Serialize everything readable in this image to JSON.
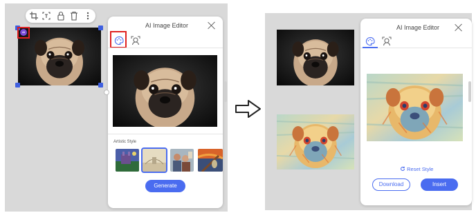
{
  "left_screen": {
    "toolbar": {
      "items": [
        {
          "icon": "crop-icon"
        },
        {
          "icon": "text-frame-icon"
        },
        {
          "icon": "lock-icon"
        },
        {
          "icon": "delete-icon"
        },
        {
          "icon": "more-vertical-icon"
        }
      ]
    },
    "ai_badge": "AI",
    "panel": {
      "title": "AI Image Editor",
      "tabs": [
        {
          "icon": "artistic-style-icon",
          "active": true
        },
        {
          "icon": "face-icon",
          "active": false
        }
      ],
      "section_label": "Artistic Style",
      "styles": [
        {
          "name": "castle-painting"
        },
        {
          "name": "beige-sketch",
          "selected": true
        },
        {
          "name": "impressionist-crowd"
        },
        {
          "name": "the-scream"
        }
      ],
      "generate_button": "Generate"
    }
  },
  "right_screen": {
    "panel": {
      "title": "AI Image Editor",
      "tabs": [
        {
          "icon": "artistic-style-icon",
          "active": true
        },
        {
          "icon": "face-icon",
          "active": false
        }
      ],
      "reset_label": "Reset Style",
      "download_button": "Download",
      "insert_button": "Insert"
    }
  },
  "colors": {
    "accent": "#4a6cf0",
    "highlight": "#e02020",
    "canvas": "#d9d9d9"
  }
}
